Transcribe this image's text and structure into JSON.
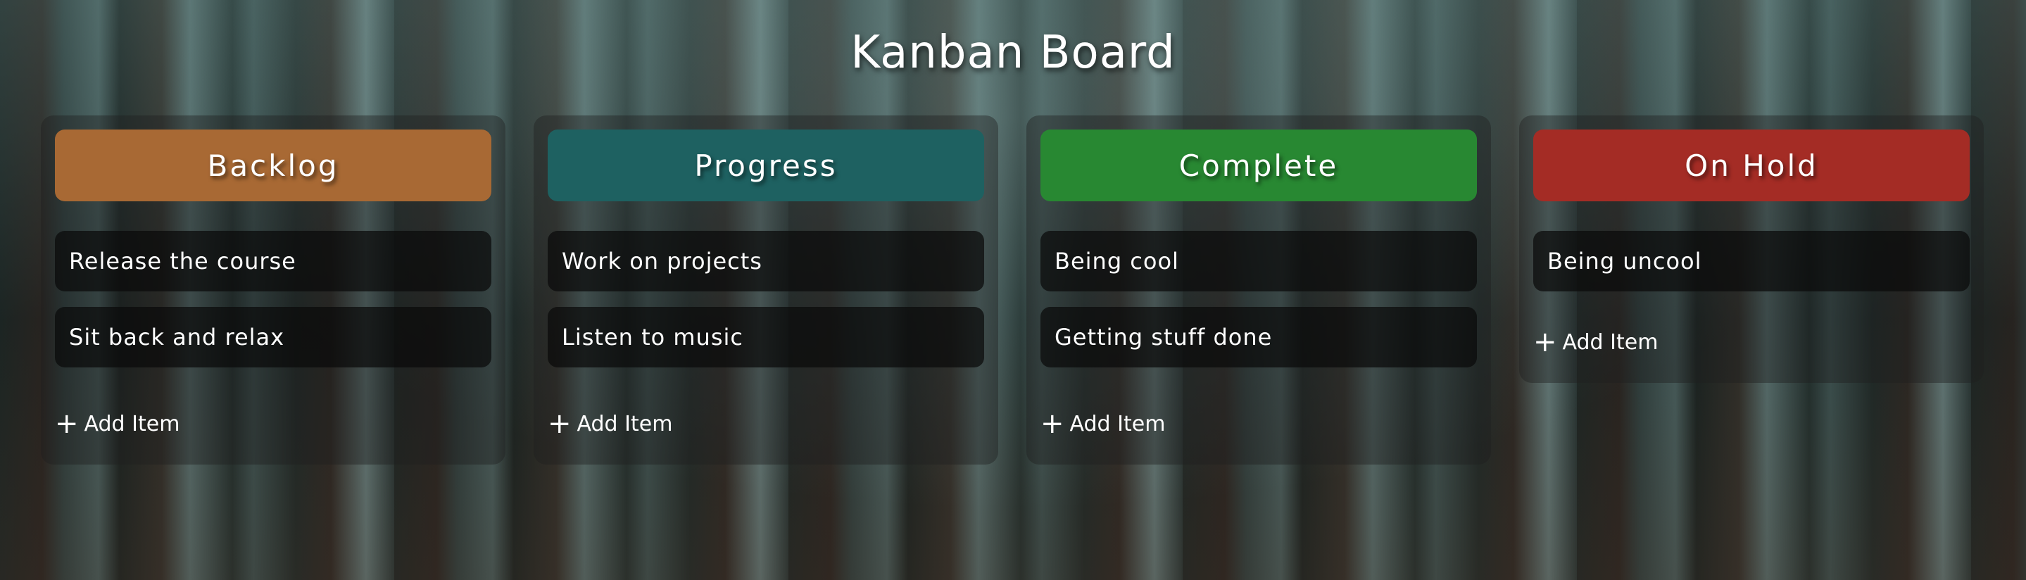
{
  "board": {
    "title": "Kanban Board"
  },
  "colors": {
    "backlog": "#a86934",
    "progress": "#1e6161",
    "complete": "#288832",
    "on_hold": "#a42c25"
  },
  "columns": [
    {
      "title": "Backlog",
      "items": [
        "Release the course",
        "Sit back and relax"
      ],
      "add_label": "Add Item",
      "add_icon": "+"
    },
    {
      "title": "Progress",
      "items": [
        "Work on projects",
        "Listen to music"
      ],
      "add_label": "Add Item",
      "add_icon": "+"
    },
    {
      "title": "Complete",
      "items": [
        "Being cool",
        "Getting stuff done"
      ],
      "add_label": "Add Item",
      "add_icon": "+"
    },
    {
      "title": "On Hold",
      "items": [
        "Being uncool"
      ],
      "add_label": "Add Item",
      "add_icon": "+"
    }
  ]
}
